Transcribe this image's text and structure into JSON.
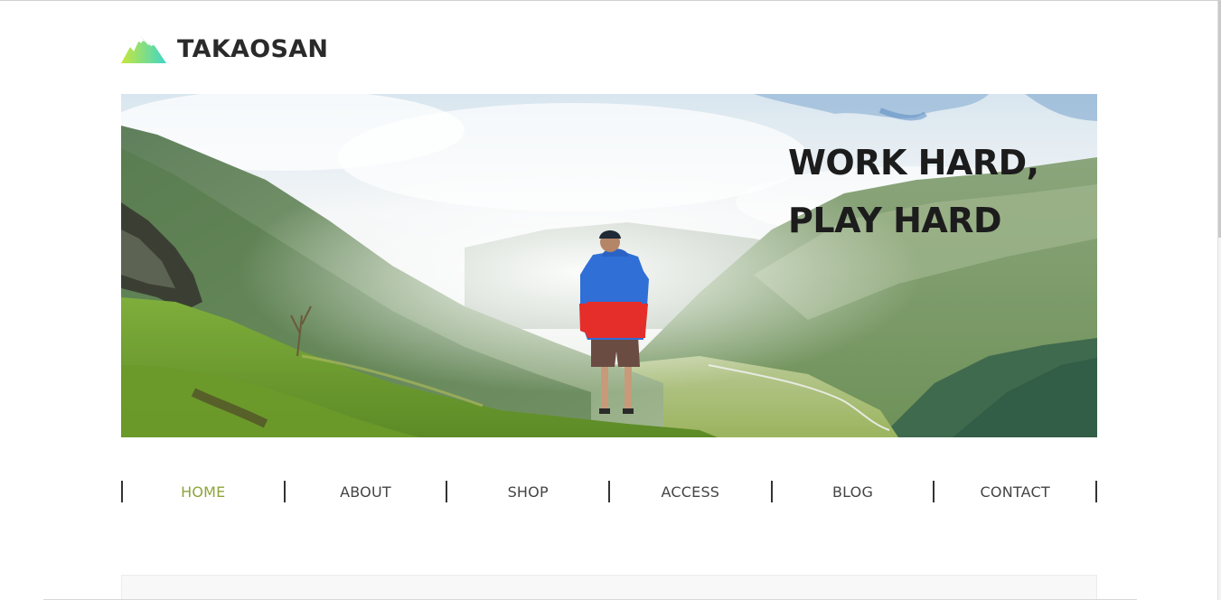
{
  "header": {
    "logo_text": "TAKAOSAN",
    "logo_icon": "mountain-icon"
  },
  "hero": {
    "line1": "WORK HARD,",
    "line2": "PLAY HARD",
    "image": "hiker-in-mountain-valley-photo"
  },
  "nav": {
    "items": [
      {
        "label": "HOME",
        "active": true
      },
      {
        "label": "ABOUT",
        "active": false
      },
      {
        "label": "SHOP",
        "active": false
      },
      {
        "label": "ACCESS",
        "active": false
      },
      {
        "label": "BLOG",
        "active": false
      },
      {
        "label": "CONTACT",
        "active": false
      }
    ]
  },
  "colors": {
    "accent": "#8ca53a",
    "text": "#444444",
    "logo": "#2a2a2a",
    "logo_gradient_start": "#c8e63c",
    "logo_gradient_end": "#3fd6c8"
  }
}
